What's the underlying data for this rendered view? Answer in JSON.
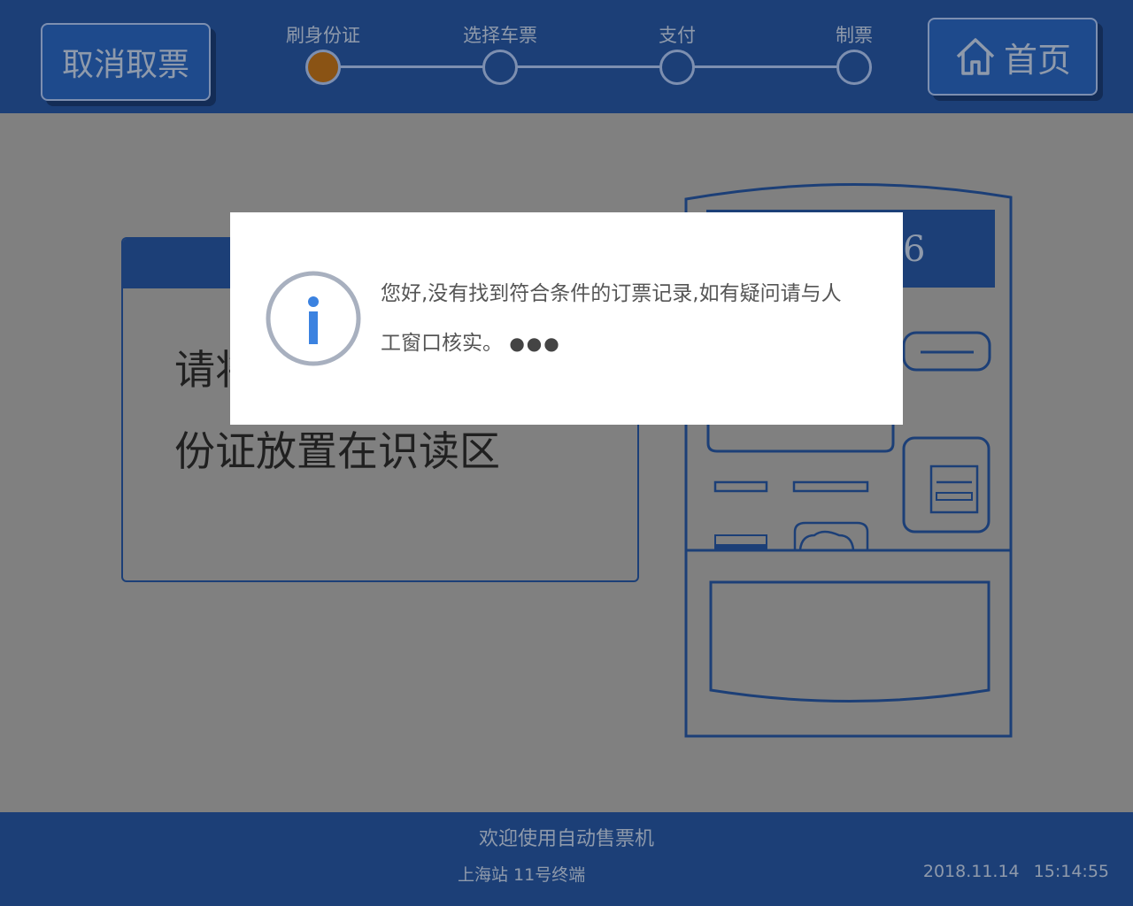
{
  "header": {
    "cancel_label": "取消取票",
    "home_label": "首页",
    "steps": [
      {
        "label": "刷身份证",
        "active": true
      },
      {
        "label": "选择车票",
        "active": false
      },
      {
        "label": "支付",
        "active": false
      },
      {
        "label": "制票",
        "active": false
      }
    ]
  },
  "main": {
    "instruction_line1": "请将",
    "instruction_line2": "份证放置在识读区",
    "machine_number": "6"
  },
  "dialog": {
    "message_line1": "您好,没有找到符合条件的订票记录,如有疑问请与人",
    "message_line2": "工窗口核实。",
    "loading_dots": "●●●"
  },
  "footer": {
    "welcome": "欢迎使用自动售票机",
    "station": "上海站 11号终端",
    "date": "2018.11.14",
    "time": "15:14:55"
  },
  "colors": {
    "header_bg": "#1c3f77",
    "active_step": "#8a5314",
    "overlay_bg": "#808080",
    "info_blue": "#3b82e0"
  }
}
